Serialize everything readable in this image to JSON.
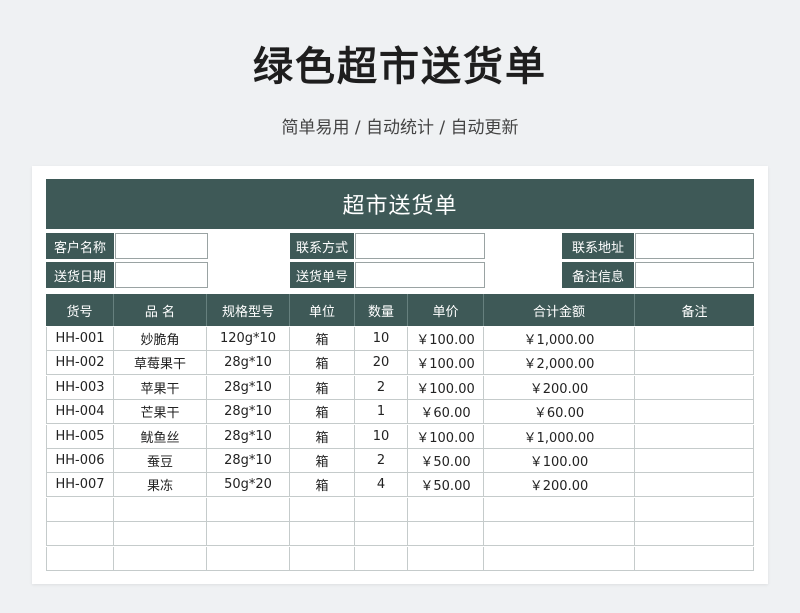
{
  "title": "绿色超市送货单",
  "subtitle": "简单易用 / 自动统计 / 自动更新",
  "sheet": {
    "banner": "超市送货单",
    "info": {
      "customer_name": "客户名称",
      "contact_method": "联系方式",
      "contact_address": "联系地址",
      "delivery_date": "送货日期",
      "delivery_no": "送货单号",
      "remarks_info": "备注信息"
    },
    "columns": [
      "货号",
      "品  名",
      "规格型号",
      "单位",
      "数量",
      "单价",
      "合计金额",
      "备注"
    ],
    "rows": [
      [
        "HH-001",
        "妙脆角",
        "120g*10",
        "箱",
        "10",
        "￥100.00",
        "￥1,000.00",
        ""
      ],
      [
        "HH-002",
        "草莓果干",
        "28g*10",
        "箱",
        "20",
        "￥100.00",
        "￥2,000.00",
        ""
      ],
      [
        "HH-003",
        "苹果干",
        "28g*10",
        "箱",
        "2",
        "￥100.00",
        "￥200.00",
        ""
      ],
      [
        "HH-004",
        "芒果干",
        "28g*10",
        "箱",
        "1",
        "￥60.00",
        "￥60.00",
        ""
      ],
      [
        "HH-005",
        "鱿鱼丝",
        "28g*10",
        "箱",
        "10",
        "￥100.00",
        "￥1,000.00",
        ""
      ],
      [
        "HH-006",
        "蚕豆",
        "28g*10",
        "箱",
        "2",
        "￥50.00",
        "￥100.00",
        ""
      ],
      [
        "HH-007",
        "果冻",
        "50g*20",
        "箱",
        "4",
        "￥50.00",
        "￥200.00",
        ""
      ],
      [
        "",
        "",
        "",
        "",
        "",
        "",
        "",
        ""
      ],
      [
        "",
        "",
        "",
        "",
        "",
        "",
        "",
        ""
      ],
      [
        "",
        "",
        "",
        "",
        "",
        "",
        "",
        ""
      ]
    ]
  }
}
